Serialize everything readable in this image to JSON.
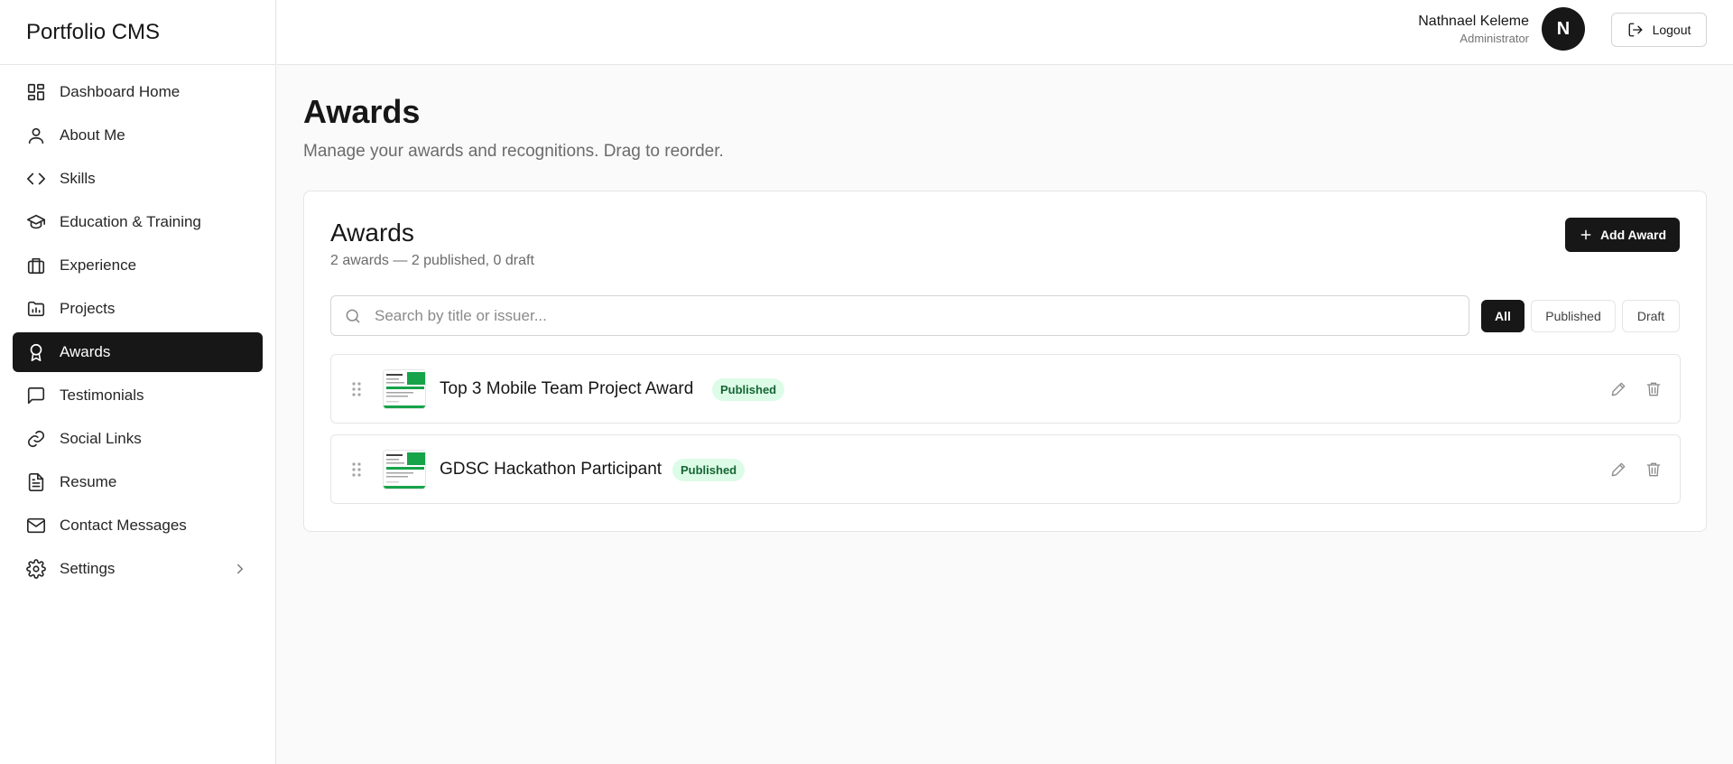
{
  "app": {
    "title": "Portfolio CMS"
  },
  "sidebar": {
    "items": [
      {
        "label": "Dashboard Home",
        "icon": "dashboard-icon"
      },
      {
        "label": "About Me",
        "icon": "user-icon"
      },
      {
        "label": "Skills",
        "icon": "code-icon"
      },
      {
        "label": "Education & Training",
        "icon": "graduation-cap-icon"
      },
      {
        "label": "Experience",
        "icon": "briefcase-icon"
      },
      {
        "label": "Projects",
        "icon": "folder-chart-icon"
      },
      {
        "label": "Awards",
        "icon": "award-icon",
        "active": true
      },
      {
        "label": "Testimonials",
        "icon": "message-square-icon"
      },
      {
        "label": "Social Links",
        "icon": "link-icon"
      },
      {
        "label": "Resume",
        "icon": "file-text-icon"
      },
      {
        "label": "Contact Messages",
        "icon": "mail-icon"
      },
      {
        "label": "Settings",
        "icon": "settings-icon"
      }
    ]
  },
  "header": {
    "user_name": "Nathnael Keleme",
    "user_role": "Administrator",
    "avatar_initial": "N",
    "logout_label": "Logout"
  },
  "page": {
    "title": "Awards",
    "subtitle": "Manage your awards and recognitions. Drag to reorder."
  },
  "card": {
    "title": "Awards",
    "count_text": "2 awards — 2 published, 0 draft",
    "add_label": "Add Award",
    "search_placeholder": "Search by title or issuer...",
    "filters": {
      "all": "All",
      "published": "Published",
      "draft": "Draft"
    },
    "active_filter": "All"
  },
  "awards": [
    {
      "title": "Top 3 Mobile Team Project Award",
      "status": "Published"
    },
    {
      "title": "GDSC Hackathon Participant",
      "status": "Published"
    }
  ],
  "colors": {
    "primary": "#171717",
    "badge_bg": "#dcfce7",
    "badge_text": "#166534",
    "thumb_green": "#16a34a"
  }
}
